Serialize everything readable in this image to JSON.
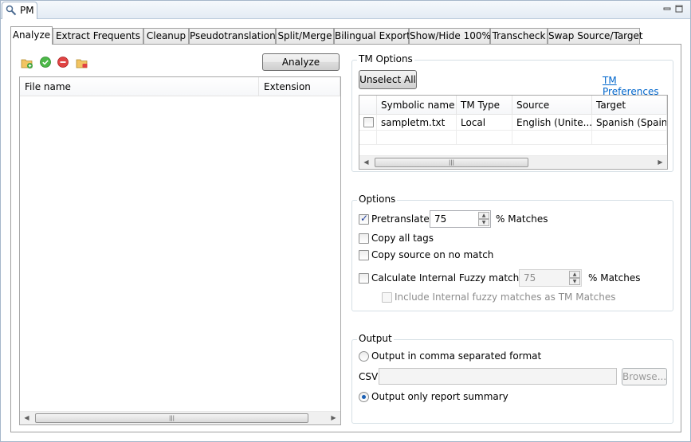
{
  "window": {
    "view_tab_label": "PM"
  },
  "tabs": [
    {
      "label": "Analyze",
      "active": true
    },
    {
      "label": "Extract Frequents",
      "active": false
    },
    {
      "label": "Cleanup",
      "active": false
    },
    {
      "label": "Pseudotranslation",
      "active": false
    },
    {
      "label": "Split/Merge",
      "active": false
    },
    {
      "label": "Bilingual Export",
      "active": false
    },
    {
      "label": "Show/Hide 100%",
      "active": false
    },
    {
      "label": "Transcheck",
      "active": false
    },
    {
      "label": "Swap Source/Target",
      "active": false
    }
  ],
  "toolbar": {
    "analyze_button": "Analyze",
    "icons": [
      "add-folder-icon",
      "accept-icon",
      "remove-icon",
      "clear-folder-icon"
    ]
  },
  "file_table": {
    "columns": [
      "File name",
      "Extension"
    ]
  },
  "tm_options": {
    "title": "TM Options",
    "unselect_all": "Unselect All",
    "preferences_link": "TM Preferences",
    "columns": [
      "Symbolic name",
      "TM Type",
      "Source",
      "Target"
    ],
    "rows": [
      {
        "checked": false,
        "symbolic_name": "sampletm.txt",
        "tm_type": "Local",
        "source": "English (Unite...",
        "target": "Spanish (Spain)"
      }
    ]
  },
  "options": {
    "title": "Options",
    "pretranslate": {
      "label": "Pretranslate",
      "checked": true,
      "value": "75",
      "suffix": "% Matches"
    },
    "copy_all_tags": {
      "label": "Copy all tags",
      "checked": false
    },
    "copy_source": {
      "label": "Copy source on no match",
      "checked": false
    },
    "internal_fuzzy": {
      "label": "Calculate Internal Fuzzy matches",
      "checked": false,
      "value": "75",
      "suffix": "% Matches"
    },
    "include_fuzzy": {
      "label": "Include Internal fuzzy matches as TM Matches",
      "checked": false
    }
  },
  "output": {
    "title": "Output",
    "csv_radio": "Output in comma separated format",
    "csv_label": "CSV",
    "csv_value": "",
    "browse_button": "Browse...",
    "summary_radio": "Output only report summary",
    "selected": "summary"
  },
  "colors": {
    "link": "#0066cc",
    "check": "#21409a",
    "radio_dot": "#1a5fb4"
  }
}
